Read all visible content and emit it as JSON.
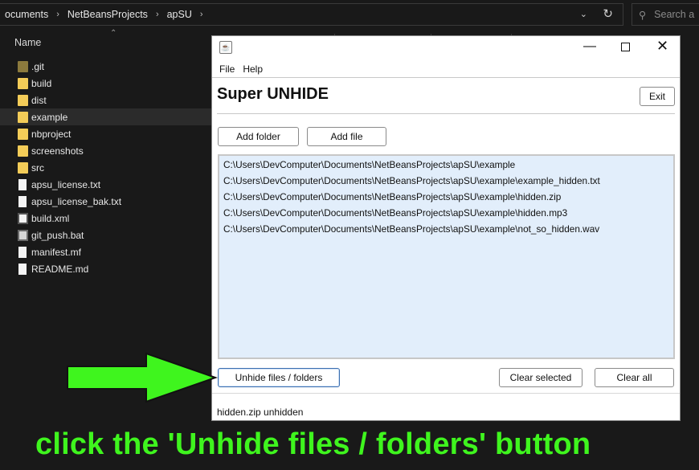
{
  "explorer": {
    "breadcrumb": [
      "ocuments",
      "NetBeansProjects",
      "apSU"
    ],
    "search_placeholder": "Search a",
    "column_name": "Name",
    "files": [
      {
        "name": ".git",
        "icon": "folder-dark-icon"
      },
      {
        "name": "build",
        "icon": "folder-icon"
      },
      {
        "name": "dist",
        "icon": "folder-icon"
      },
      {
        "name": "example",
        "icon": "folder-icon",
        "selected": true
      },
      {
        "name": "nbproject",
        "icon": "folder-icon"
      },
      {
        "name": "screenshots",
        "icon": "folder-icon"
      },
      {
        "name": "src",
        "icon": "folder-icon"
      },
      {
        "name": "apsu_license.txt",
        "icon": "text-file-icon"
      },
      {
        "name": "apsu_license_bak.txt",
        "icon": "text-file-icon"
      },
      {
        "name": "build.xml",
        "icon": "xml-file-icon"
      },
      {
        "name": "git_push.bat",
        "icon": "batch-file-icon"
      },
      {
        "name": "manifest.mf",
        "icon": "file-icon"
      },
      {
        "name": "README.md",
        "icon": "file-icon"
      }
    ]
  },
  "app": {
    "menu": [
      "File",
      "Help"
    ],
    "title": "Super UNHIDE",
    "exit_label": "Exit",
    "add_folder_label": "Add folder",
    "add_file_label": "Add file",
    "list_items": [
      "C:\\Users\\DevComputer\\Documents\\NetBeansProjects\\apSU\\example",
      "C:\\Users\\DevComputer\\Documents\\NetBeansProjects\\apSU\\example\\example_hidden.txt",
      "C:\\Users\\DevComputer\\Documents\\NetBeansProjects\\apSU\\example\\hidden.zip",
      "C:\\Users\\DevComputer\\Documents\\NetBeansProjects\\apSU\\example\\hidden.mp3",
      "C:\\Users\\DevComputer\\Documents\\NetBeansProjects\\apSU\\example\\not_so_hidden.wav"
    ],
    "unhide_label": "Unhide files / folders",
    "clear_selected_label": "Clear selected",
    "clear_all_label": "Clear all",
    "status": "hidden.zip unhidden"
  },
  "overlay": {
    "caption": "click the 'Unhide files / folders' button",
    "arrow_color": "#3ff51e"
  }
}
